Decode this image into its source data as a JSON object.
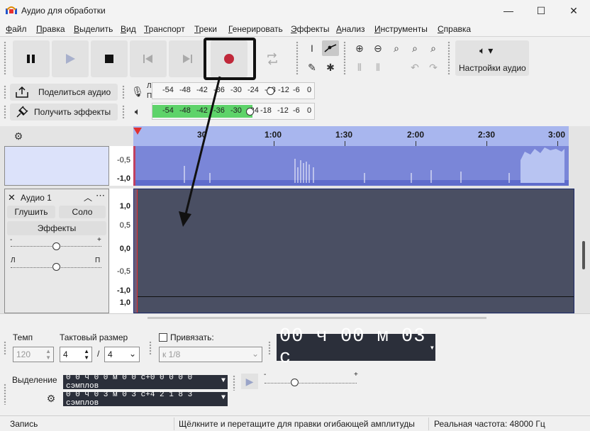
{
  "window": {
    "title": "Аудио для обработки",
    "controls": [
      "—",
      "☐",
      "✕"
    ]
  },
  "menu": [
    {
      "label": "Файл",
      "u": "Ф",
      "rest": "айл"
    },
    {
      "label": "Правка",
      "u": "П",
      "rest": "равка"
    },
    {
      "label": "Выделить",
      "u": "В",
      "rest": "ыделить"
    },
    {
      "label": "Вид",
      "u": "В",
      "rest": "ид"
    },
    {
      "label": "Транспорт",
      "u": "Т",
      "rest": "ранспорт"
    },
    {
      "label": "Треки",
      "u": "Т",
      "rest": "реки"
    },
    {
      "label": "Генерировать",
      "u": "Г",
      "rest": "енерировать"
    },
    {
      "label": "Эффекты",
      "u": "Э",
      "rest": "ффекты"
    },
    {
      "label": "Анализ",
      "u": "А",
      "rest": "нализ"
    },
    {
      "label": "Инструменты",
      "u": "И",
      "rest": "нструменты"
    },
    {
      "label": "Справка",
      "u": "С",
      "rest": "правка"
    }
  ],
  "toolbar": {
    "audio_settings": "Настройки аудио",
    "share_audio": "Поделиться аудио",
    "get_effects": "Получить эффекты"
  },
  "meters": {
    "record_ticks": [
      "-54",
      "-48",
      "-42",
      "-36",
      "-30",
      "-24",
      "-18",
      "-12",
      "-6",
      "0"
    ],
    "play_ticks": [
      "-54",
      "-48",
      "-42",
      "-36",
      "-30",
      "-24",
      "-18",
      "-12",
      "-6",
      "0"
    ],
    "channel_l": "Л",
    "channel_p": "П"
  },
  "ruler": {
    "ticks": [
      "30",
      "1:00",
      "1:30",
      "2:00",
      "2:30",
      "3:00"
    ]
  },
  "track1": {
    "scale": [
      "-0,5",
      "-1,0"
    ]
  },
  "track2": {
    "name": "Аудио 1",
    "mute": "Глушить",
    "solo": "Соло",
    "effects": "Эффекты",
    "gain_minus": "-",
    "gain_plus": "+",
    "pan_left": "Л",
    "pan_right": "П",
    "scale": [
      "1,0",
      "0,5",
      "0,0",
      "-0,5",
      "-1,0",
      "1,0"
    ]
  },
  "bottom": {
    "tempo_label": "Темп",
    "tempo_value": "120",
    "time_sig_label": "Тактовый размер",
    "time_sig_num": "4",
    "time_sig_sep": "/",
    "time_sig_den": "4",
    "snap_label": "Привязать:",
    "snap_value": "к 1/8",
    "time_display": "00 ч 00 м 03 с",
    "selection_label": "Выделение",
    "selection_start": "0 0 ч 0 0 м 0 0 с+0 0 0 0 0  сэмплов",
    "selection_end": "0 0 ч 0 3 м 0 3 с+4 2 1 8 3  сэмплов",
    "play_speed_minus": "-",
    "play_speed_plus": "+"
  },
  "status": {
    "state": "Запись",
    "hint": "Щёлкните и перетащите для правки огибающей амплитуды",
    "rate": "Реальная частота: 48000 Гц"
  },
  "colors": {
    "record": "#c0283a",
    "meter_green": "#5ed36a",
    "waveform": "#7a86d8",
    "track_bg": "#4a4f63",
    "ruler": "#a8b6ee"
  }
}
